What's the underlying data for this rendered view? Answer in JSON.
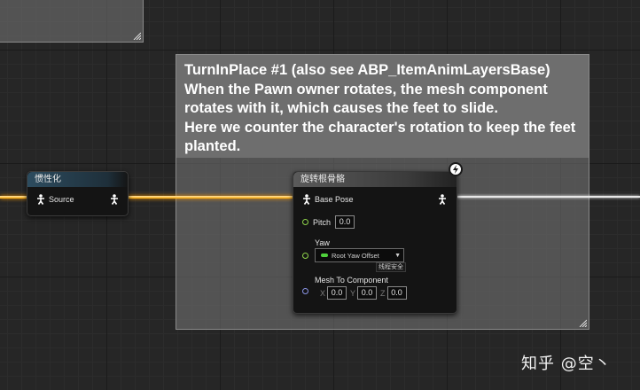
{
  "comment": {
    "text": "TurnInPlace #1 (also see ABP_ItemAnimLayersBase)\nWhen the Pawn owner rotates, the mesh component rotates with it, which causes the feet to slide.\nHere we counter the character's rotation to keep the feet planted."
  },
  "inertial_node": {
    "title": "惯性化",
    "source_label": "Source"
  },
  "rotate_node": {
    "title": "旋转根骨骼",
    "base_pose_label": "Base Pose",
    "pitch_label": "Pitch",
    "pitch_value": "0.0",
    "yaw_label": "Yaw",
    "yaw_dropdown": "Root Yaw Offset",
    "thread_safe": "线程安全",
    "mesh_label": "Mesh To Component",
    "mesh_x_label": "X",
    "mesh_x": "0.0",
    "mesh_y_label": "Y",
    "mesh_y": "0.0",
    "mesh_z_label": "Z",
    "mesh_z": "0.0"
  },
  "watermark": "知乎 @空丶",
  "colors": {
    "exec_wire": "#f5a300",
    "pose_wire": "#e8e8e8",
    "float_pin": "#8fd44a",
    "vector_pin": "#8a94e6"
  },
  "icons": [
    "pose-icon",
    "lightning-icon",
    "resize-grip-icon",
    "dropdown-arrow-icon"
  ]
}
